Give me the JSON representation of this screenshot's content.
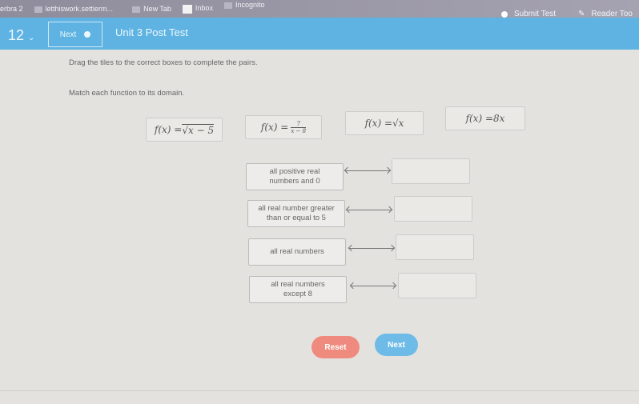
{
  "browser": {
    "bookmarks": [
      "erbra 2",
      "letthiswork.settierm...",
      "New Tab",
      "Inbox",
      "Incognito"
    ]
  },
  "header": {
    "question_number": "12",
    "next_label": "Next",
    "title": "Unit 3 Post Test",
    "submit_label": "Submit Test",
    "reader_label": "Reader Too"
  },
  "instructions": [
    "Drag the tiles to the correct boxes to complete the pairs.",
    "Match each function to its domain."
  ],
  "tiles": [
    {
      "prefix": "f(x) = ",
      "text": "√x − 5"
    },
    {
      "prefix": "f(x) = ",
      "num": "7",
      "den": "x − 8"
    },
    {
      "prefix": "f(x) = ",
      "text": "√x"
    },
    {
      "prefix": "f(x) = ",
      "text": "8x"
    }
  ],
  "domains": [
    {
      "line1": "all positive real",
      "line2": "numbers and 0"
    },
    {
      "line1": "all real number greater",
      "line2": "than or equal to 5"
    },
    {
      "line1": "all real numbers",
      "line2": ""
    },
    {
      "line1": "all real numbers",
      "line2": "except 8"
    }
  ],
  "buttons": {
    "reset": "Reset",
    "next": "Next"
  },
  "colors": {
    "header": "#5eb3e2",
    "reset": "#ef8b7e",
    "next": "#6fbbe8"
  }
}
